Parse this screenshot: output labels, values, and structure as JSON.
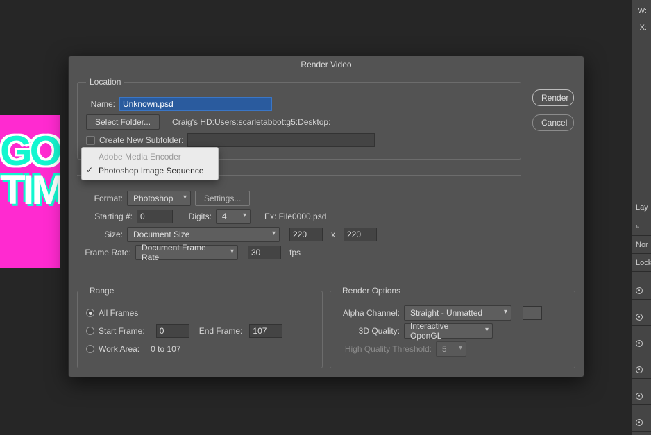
{
  "bg_art": {
    "line1": "GO",
    "line2": "TIM"
  },
  "right_panel": {
    "w_label": "W:",
    "x_label": "X:",
    "layers_label": "Lay",
    "search_prefix": "⌕",
    "kind": "Nor",
    "lock_label": "Lock"
  },
  "dialog": {
    "title": "Render Video",
    "render_btn": "Render",
    "cancel_btn": "Cancel",
    "location": {
      "legend": "Location",
      "name_label": "Name:",
      "name_value": "Unknown.psd",
      "select_folder_btn": "Select Folder...",
      "folder_path": "Craig's HD:Users:scarletabbottg5:Desktop:",
      "create_subfolder_label": "Create New Subfolder:"
    },
    "encoder_menu": {
      "options": [
        "Adobe Media Encoder",
        "Photoshop Image Sequence"
      ],
      "selected_index": 1
    },
    "image_sequence": {
      "format_label": "Format:",
      "format_value": "Photoshop",
      "settings_btn": "Settings...",
      "starting_label": "Starting #:",
      "starting_value": "0",
      "digits_label": "Digits:",
      "digits_value": "4",
      "example": "Ex: File0000.psd",
      "size_label": "Size:",
      "size_preset": "Document Size",
      "size_w": "220",
      "size_by": "x",
      "size_h": "220",
      "framerate_label": "Frame Rate:",
      "framerate_preset": "Document Frame Rate",
      "framerate_value": "30",
      "framerate_unit": "fps"
    },
    "range": {
      "legend": "Range",
      "all_frames": "All Frames",
      "start_frame_label": "Start Frame:",
      "start_frame_value": "0",
      "end_frame_label": "End Frame:",
      "end_frame_value": "107",
      "work_area_label": "Work Area:",
      "work_area_value": "0 to 107"
    },
    "render_options": {
      "legend": "Render Options",
      "alpha_label": "Alpha Channel:",
      "alpha_value": "Straight - Unmatted",
      "quality3d_label": "3D Quality:",
      "quality3d_value": "Interactive OpenGL",
      "hq_threshold_label": "High Quality Threshold:",
      "hq_threshold_value": "5"
    }
  }
}
